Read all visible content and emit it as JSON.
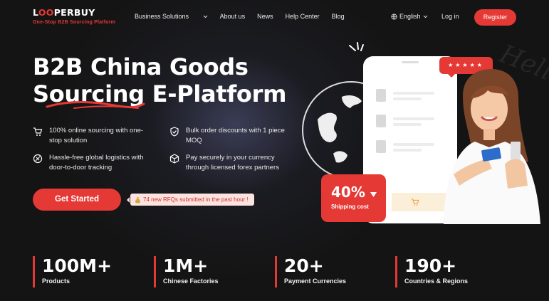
{
  "brand": {
    "name_pre": "L",
    "name_o": "OO",
    "name_post": "PERBUY",
    "tagline": "One-Stop B2B Sourcing Platform"
  },
  "nav": {
    "items": [
      "Business Solutions",
      "About us",
      "News",
      "Help Center",
      "Blog"
    ],
    "language": "English",
    "login": "Log in",
    "register": "Register"
  },
  "hero": {
    "title_line1": "B2B China Goods",
    "title_line2": "Sourcing E-Platform",
    "features": [
      {
        "icon": "cart-icon",
        "text_line1": "100% online sourcing with one-",
        "text_line2": "stop solution"
      },
      {
        "icon": "shield-check-icon",
        "text_line1": "Bulk order discounts with 1 piece",
        "text_line2": "MOQ"
      },
      {
        "icon": "no-hassle-icon",
        "text_line1": "Hassle-free global logistics with",
        "text_line2": "door-to-door tracking"
      },
      {
        "icon": "box-icon",
        "text_line1": "Pay securely in your currency",
        "text_line2": "through licensed forex partners"
      }
    ],
    "cta": "Get Started",
    "rfq_icon": "money-bag-icon",
    "rfq_text": "74 new RFQs submitted in the past hour !"
  },
  "illustration": {
    "stars": "★★★★★",
    "shipping_value": "40%",
    "shipping_label": "Shipping cost",
    "watermark": "Hello"
  },
  "stats": [
    {
      "value": "100M+",
      "label": "Products"
    },
    {
      "value": "1M+",
      "label": "Chinese Factories"
    },
    {
      "value": "20+",
      "label": "Payment Currencies"
    },
    {
      "value": "190+",
      "label": "Countries & Regions"
    }
  ],
  "colors": {
    "accent": "#e53935",
    "background": "#141414",
    "text": "#ffffff",
    "rfq_bg": "#fbe3df"
  }
}
